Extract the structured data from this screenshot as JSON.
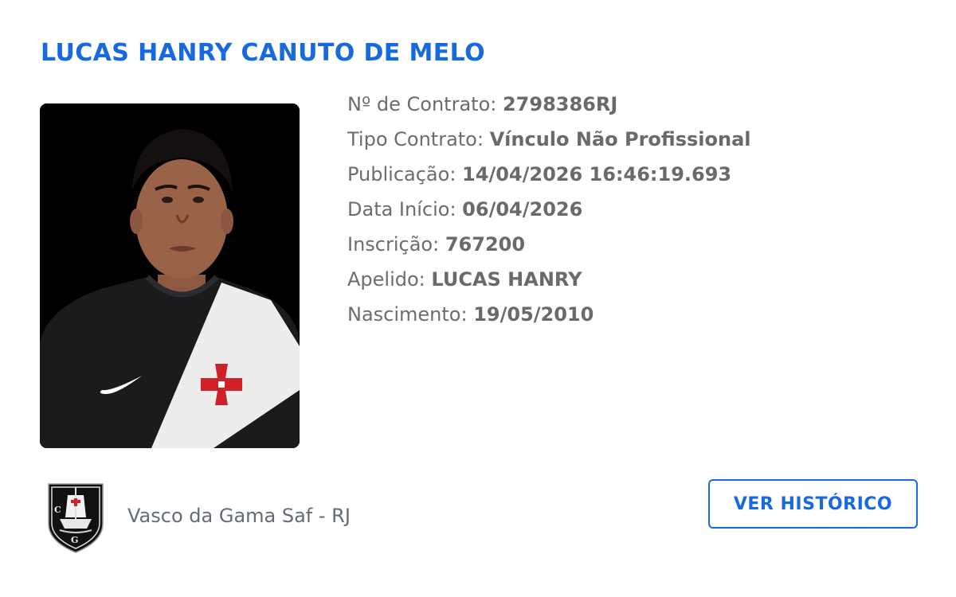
{
  "player": {
    "name": "LUCAS HANRY CANUTO DE MELO"
  },
  "details": [
    {
      "label": "Nº de Contrato:",
      "value": "2798386RJ"
    },
    {
      "label": "Tipo Contrato:",
      "value": "Vínculo Não Profissional"
    },
    {
      "label": "Publicação:",
      "value": "14/04/2026 16:46:19.693"
    },
    {
      "label": "Data Início:",
      "value": "06/04/2026"
    },
    {
      "label": "Inscrição:",
      "value": "767200"
    },
    {
      "label": "Apelido:",
      "value": "LUCAS HANRY"
    },
    {
      "label": "Nascimento:",
      "value": "19/05/2010"
    }
  ],
  "club": {
    "name": "Vasco da Gama Saf - RJ",
    "crest_icon": "vasco-crest-icon"
  },
  "actions": {
    "history_label": "VER HISTÓRICO"
  },
  "colors": {
    "accent": "#1769e0",
    "label_text": "#6c6c6c",
    "club_text": "#666c74"
  }
}
